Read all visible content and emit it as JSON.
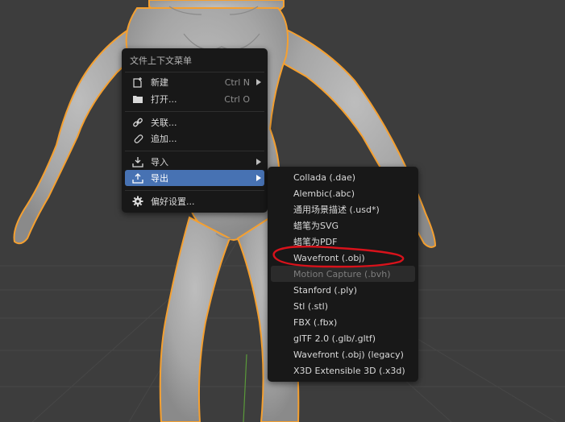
{
  "context_menu": {
    "title": "文件上下文菜单",
    "items": [
      {
        "label": "新建",
        "shortcut": "Ctrl N",
        "icon": "new-file-icon"
      },
      {
        "label": "打开...",
        "shortcut": "Ctrl O",
        "icon": "folder-icon"
      },
      {
        "label": "关联...",
        "icon": "link-icon"
      },
      {
        "label": "追加...",
        "icon": "paperclip-icon"
      },
      {
        "label": "导入",
        "icon": "import-icon"
      },
      {
        "label": "导出",
        "icon": "export-icon",
        "selected": true
      },
      {
        "label": "偏好设置...",
        "icon": "gear-icon"
      }
    ]
  },
  "export_submenu": {
    "items": [
      {
        "label": "Collada (.dae)"
      },
      {
        "label": "Alembic(.abc)"
      },
      {
        "label": "通用场景描述 (.usd*)"
      },
      {
        "label": "蜡笔为SVG"
      },
      {
        "label": "蜡笔为PDF"
      },
      {
        "label": "Wavefront (.obj)",
        "annotated": true
      },
      {
        "label": "Motion Capture (.bvh)",
        "disabled": true
      },
      {
        "label": "Stanford (.ply)"
      },
      {
        "label": "Stl (.stl)"
      },
      {
        "label": "FBX (.fbx)"
      },
      {
        "label": "glTF 2.0 (.glb/.gltf)"
      },
      {
        "label": "Wavefront (.obj) (legacy)"
      },
      {
        "label": "X3D Extensible 3D (.x3d)"
      }
    ]
  },
  "colors": {
    "menu_bg": "#181818",
    "selected": "#4772b3",
    "outline": "#f5a030",
    "annotation": "#d8121b",
    "viewport_bg": "#3d3d3d"
  }
}
